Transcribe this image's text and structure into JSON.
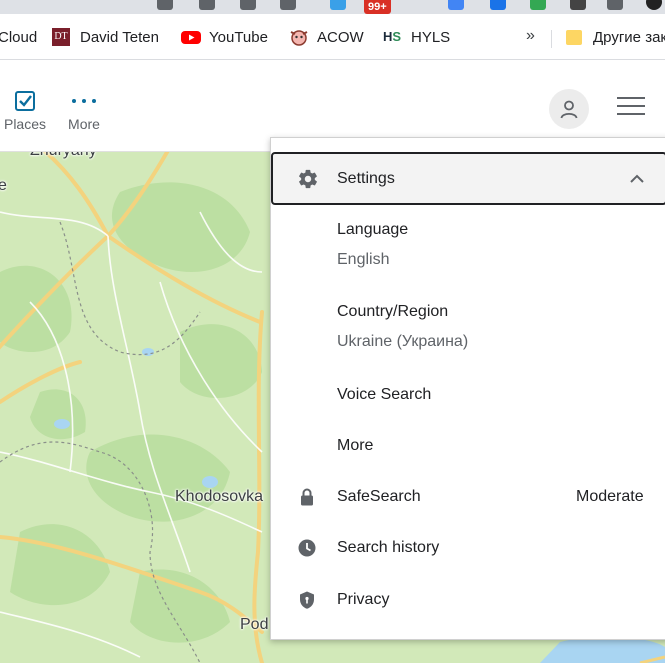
{
  "browser": {
    "notification_badge": "99+",
    "bookmarks": [
      {
        "label": "Cloud",
        "icon": "cloud-icon"
      },
      {
        "label": "David Teten",
        "icon": "dt-favicon"
      },
      {
        "label": "YouTube",
        "icon": "youtube-icon"
      },
      {
        "label": "ACOW",
        "icon": "acow-favicon"
      },
      {
        "label": "HYLS",
        "icon": "hyls-favicon"
      }
    ],
    "overflow_chevron": "»",
    "other_bookmarks": "Другие зак"
  },
  "header": {
    "nav": [
      {
        "label": "Places",
        "icon": "checkbox-icon"
      },
      {
        "label": "More",
        "icon": "more-dots-icon"
      }
    ]
  },
  "map": {
    "labels": {
      "zhuryany": "Zhuryany",
      "khodosovka": "Khodosovka",
      "pod": "Pod",
      "left_e": "e"
    }
  },
  "settings_menu": {
    "header": "Settings",
    "language_label": "Language",
    "language_value": "English",
    "region_label": "Country/Region",
    "region_value": "Ukraine (Украина)",
    "voice_search": "Voice Search",
    "more": "More",
    "safesearch_label": "SafeSearch",
    "safesearch_value": "Moderate",
    "search_history": "Search history",
    "privacy": "Privacy"
  },
  "colors": {
    "map_green": "#d2e9b9",
    "accent_teal": "#0b6e9e",
    "youtube_red": "#ff0000",
    "badge_red": "#d93025"
  }
}
